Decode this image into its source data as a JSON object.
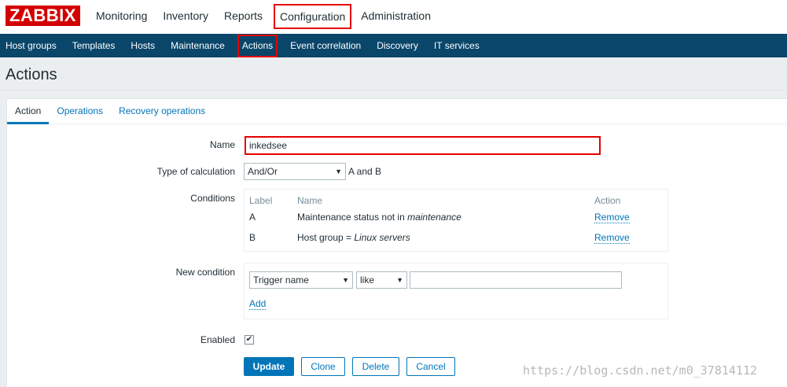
{
  "logo": {
    "text": "ZABBIX"
  },
  "main_menu": [
    {
      "label": "Monitoring"
    },
    {
      "label": "Inventory"
    },
    {
      "label": "Reports"
    },
    {
      "label": "Configuration"
    },
    {
      "label": "Administration"
    }
  ],
  "sub_menu": [
    {
      "label": "Host groups"
    },
    {
      "label": "Templates"
    },
    {
      "label": "Hosts"
    },
    {
      "label": "Maintenance"
    },
    {
      "label": "Actions"
    },
    {
      "label": "Event correlation"
    },
    {
      "label": "Discovery"
    },
    {
      "label": "IT services"
    }
  ],
  "page": {
    "title": "Actions"
  },
  "tabs": [
    {
      "label": "Action"
    },
    {
      "label": "Operations"
    },
    {
      "label": "Recovery operations"
    }
  ],
  "form": {
    "name_label": "Name",
    "name_value": "inkedsee",
    "calc_label": "Type of calculation",
    "calc_value": "And/Or",
    "calc_expression": "A and B",
    "conditions_label": "Conditions",
    "conditions_headers": {
      "label": "Label",
      "name": "Name",
      "action": "Action"
    },
    "conditions": [
      {
        "label": "A",
        "name_prefix": "Maintenance status not in ",
        "name_italic": "maintenance",
        "action": "Remove"
      },
      {
        "label": "B",
        "name_prefix": "Host group = ",
        "name_italic": "Linux servers",
        "action": "Remove"
      }
    ],
    "new_condition_label": "New condition",
    "new_condition_type": "Trigger name",
    "new_condition_operator": "like",
    "new_condition_value": "",
    "add_label": "Add",
    "enabled_label": "Enabled",
    "enabled_check": "✔"
  },
  "buttons": {
    "update": "Update",
    "clone": "Clone",
    "delete": "Delete",
    "cancel": "Cancel"
  },
  "watermark": "https://blog.csdn.net/m0_37814112",
  "colors": {
    "brand": "#d40000",
    "submenu_bg": "#0a466a",
    "accent": "#0275b8",
    "highlight": "#e60000"
  }
}
